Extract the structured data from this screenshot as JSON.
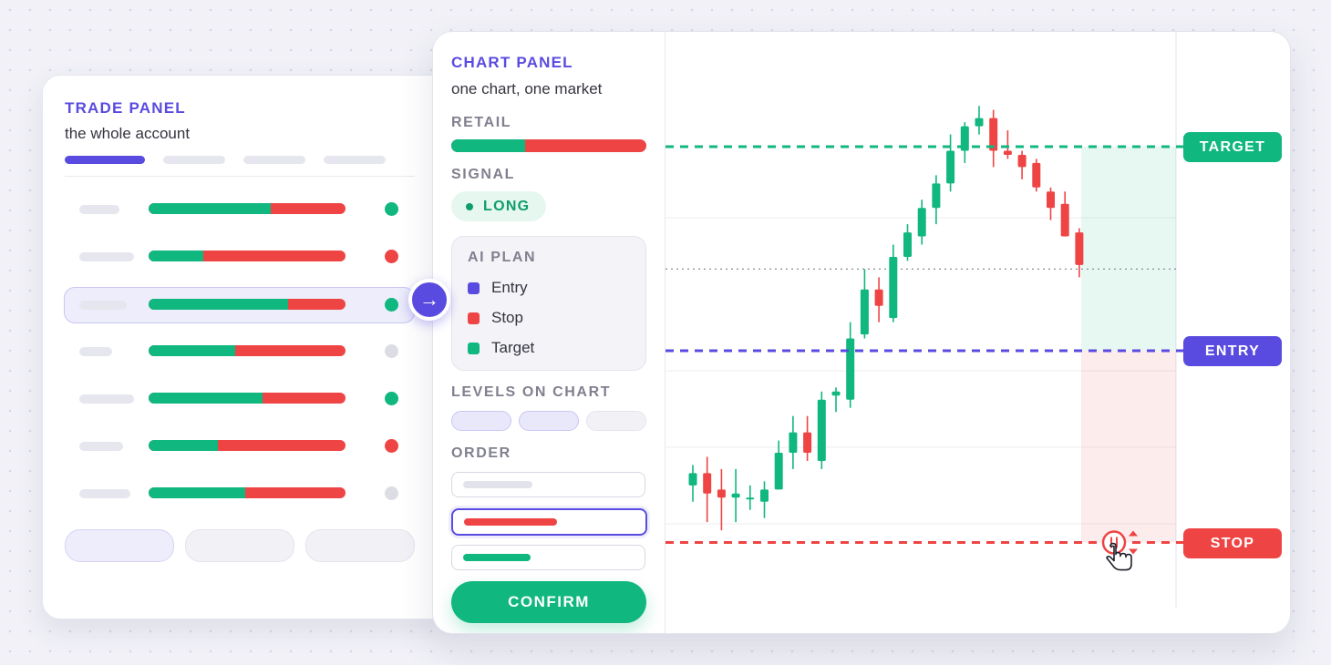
{
  "colors": {
    "accent": "#5a4be0",
    "green": "#10b77f",
    "red": "#ef4444",
    "muted": "#80808f"
  },
  "trade_panel": {
    "title": "TRADE PANEL",
    "subtitle": "the whole account",
    "rows": [
      {
        "green_fraction": 0.62,
        "status": "green"
      },
      {
        "green_fraction": 0.28,
        "status": "red"
      },
      {
        "green_fraction": 0.71,
        "status": "green",
        "selected": true
      },
      {
        "green_fraction": 0.44,
        "status": "gray"
      },
      {
        "green_fraction": 0.58,
        "status": "green"
      },
      {
        "green_fraction": 0.35,
        "status": "red"
      },
      {
        "green_fraction": 0.49,
        "status": "gray"
      }
    ],
    "arrow_icon": "arrow-right-icon"
  },
  "chart_panel": {
    "title": "CHART PANEL",
    "subtitle": "one chart, one market",
    "retail_label": "RETAIL",
    "retail_long_fraction": 0.38,
    "signal_label": "SIGNAL",
    "signal_value": "LONG",
    "ai_plan": {
      "title": "AI PLAN",
      "items": [
        {
          "label": "Entry",
          "color": "#5a4be0"
        },
        {
          "label": "Stop",
          "color": "#ef4444"
        },
        {
          "label": "Target",
          "color": "#10b77f"
        }
      ]
    },
    "levels_label": "LEVELS ON CHART",
    "order_label": "ORDER",
    "confirm_label": "CONFIRM"
  },
  "chart": {
    "levels": {
      "target": "TARGET",
      "entry": "ENTRY",
      "stop": "STOP"
    },
    "drag_icon": "pointer-hand-icon"
  },
  "chart_data": {
    "type": "candlestick",
    "price_range": [
      95,
      112
    ],
    "levels": {
      "target": 110,
      "entry": 105,
      "stop": 100.3
    },
    "current_price": 107,
    "candles": [
      {
        "o": 101.7,
        "h": 102.2,
        "l": 101.3,
        "c": 102.0
      },
      {
        "o": 102.0,
        "h": 102.4,
        "l": 100.8,
        "c": 101.5
      },
      {
        "o": 101.6,
        "h": 102.1,
        "l": 100.6,
        "c": 101.4
      },
      {
        "o": 101.4,
        "h": 102.1,
        "l": 100.8,
        "c": 101.5
      },
      {
        "o": 101.4,
        "h": 101.7,
        "l": 101.1,
        "c": 101.4
      },
      {
        "o": 101.3,
        "h": 101.8,
        "l": 100.9,
        "c": 101.6
      },
      {
        "o": 101.6,
        "h": 102.8,
        "l": 101.6,
        "c": 102.5
      },
      {
        "o": 102.5,
        "h": 103.4,
        "l": 102.1,
        "c": 103.0
      },
      {
        "o": 103.0,
        "h": 103.4,
        "l": 102.3,
        "c": 102.5
      },
      {
        "o": 102.3,
        "h": 104.0,
        "l": 102.1,
        "c": 103.8
      },
      {
        "o": 103.9,
        "h": 104.1,
        "l": 103.5,
        "c": 104.0
      },
      {
        "o": 103.8,
        "h": 105.7,
        "l": 103.6,
        "c": 105.3
      },
      {
        "o": 105.4,
        "h": 107.0,
        "l": 105.3,
        "c": 106.5
      },
      {
        "o": 106.5,
        "h": 106.8,
        "l": 105.7,
        "c": 106.1
      },
      {
        "o": 105.8,
        "h": 107.6,
        "l": 105.7,
        "c": 107.3
      },
      {
        "o": 107.3,
        "h": 108.1,
        "l": 107.2,
        "c": 107.9
      },
      {
        "o": 107.8,
        "h": 108.7,
        "l": 107.6,
        "c": 108.5
      },
      {
        "o": 108.5,
        "h": 109.3,
        "l": 108.1,
        "c": 109.1
      },
      {
        "o": 109.1,
        "h": 110.3,
        "l": 108.9,
        "c": 109.9
      },
      {
        "o": 109.9,
        "h": 110.6,
        "l": 109.6,
        "c": 110.5
      },
      {
        "o": 110.5,
        "h": 111.0,
        "l": 110.3,
        "c": 110.7
      },
      {
        "o": 110.7,
        "h": 110.9,
        "l": 109.5,
        "c": 109.9
      },
      {
        "o": 109.9,
        "h": 110.4,
        "l": 109.7,
        "c": 109.8
      },
      {
        "o": 109.8,
        "h": 109.9,
        "l": 109.2,
        "c": 109.5
      },
      {
        "o": 109.6,
        "h": 109.7,
        "l": 108.9,
        "c": 109.0
      },
      {
        "o": 108.9,
        "h": 109.0,
        "l": 108.2,
        "c": 108.5
      },
      {
        "o": 108.6,
        "h": 108.9,
        "l": 107.8,
        "c": 107.8
      },
      {
        "o": 107.9,
        "h": 108.0,
        "l": 106.8,
        "c": 107.1
      }
    ]
  }
}
